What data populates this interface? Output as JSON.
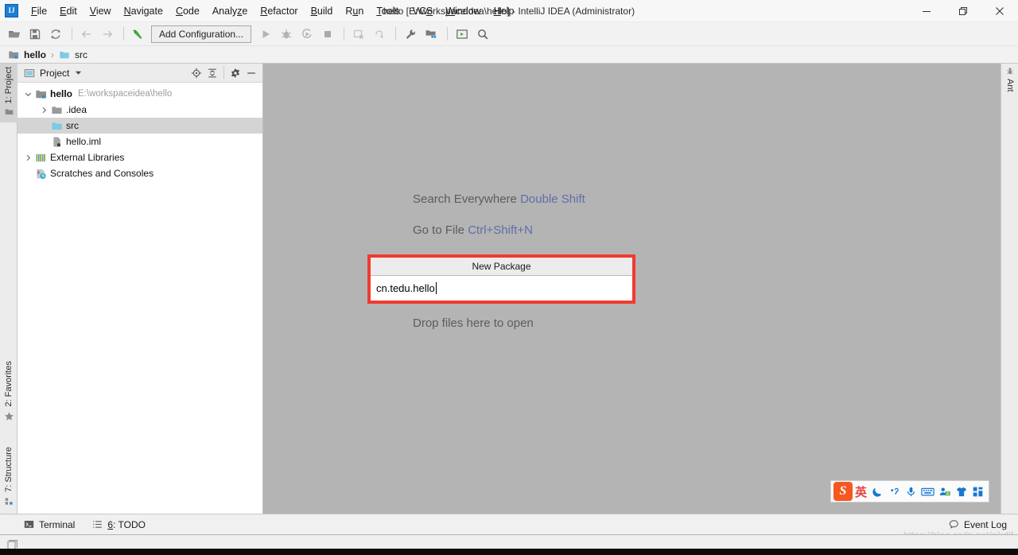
{
  "window": {
    "title": "hello [E:\\workspaceidea\\hello] - IntelliJ IDEA (Administrator)",
    "app_icon": "intellij-idea-logo",
    "controls": {
      "minimize": "minimize-icon",
      "maximize": "maximize-icon",
      "close": "close-icon"
    }
  },
  "menubar": {
    "items": [
      {
        "label": "File",
        "mnemonic": "F"
      },
      {
        "label": "Edit",
        "mnemonic": "E"
      },
      {
        "label": "View",
        "mnemonic": "V"
      },
      {
        "label": "Navigate",
        "mnemonic": "N"
      },
      {
        "label": "Code",
        "mnemonic": "C"
      },
      {
        "label": "Analyze",
        "mnemonic": "z"
      },
      {
        "label": "Refactor",
        "mnemonic": "R"
      },
      {
        "label": "Build",
        "mnemonic": "B"
      },
      {
        "label": "Run",
        "mnemonic": "u"
      },
      {
        "label": "Tools",
        "mnemonic": "T"
      },
      {
        "label": "VCS",
        "mnemonic": "S"
      },
      {
        "label": "Window",
        "mnemonic": "W"
      },
      {
        "label": "Help",
        "mnemonic": "H"
      }
    ]
  },
  "toolbar": {
    "run_configuration": "Add Configuration...",
    "icons": [
      "open-folder-icon",
      "save-all-icon",
      "sync-icon",
      "navigate-back-icon",
      "navigate-forward-icon",
      "build-hammer-icon",
      "run-icon",
      "debug-icon",
      "run-with-coverage-icon",
      "stop-icon",
      "attach-profiler-icon",
      "update-project-icon",
      "settings-wrench-icon",
      "project-structure-icon",
      "terminal-icon",
      "search-icon"
    ]
  },
  "breadcrumb": {
    "items": [
      {
        "label": "hello",
        "icon": "module-icon",
        "bold": true
      },
      {
        "label": "src",
        "icon": "source-folder-icon",
        "bold": false
      }
    ],
    "separator": "›"
  },
  "left_tool_strip": {
    "tabs": [
      {
        "label": "1: Project",
        "mnemonic": "1",
        "icon": "project-icon",
        "active": true
      },
      {
        "label": "2: Favorites",
        "mnemonic": "2",
        "icon": "star-icon",
        "active": false
      },
      {
        "label": "7: Structure",
        "mnemonic": "7",
        "icon": "structure-icon",
        "active": false
      }
    ]
  },
  "right_tool_strip": {
    "tabs": [
      {
        "label": "Ant",
        "icon": "ant-icon",
        "active": false
      }
    ]
  },
  "project_panel": {
    "title": "Project",
    "dropdown_icon": "chevron-down-icon",
    "view_icon": "project-view-icon",
    "actions": [
      "locate-icon",
      "collapse-all-icon",
      "settings-gear-icon",
      "hide-icon"
    ],
    "tree": [
      {
        "label": "hello",
        "path": "E:\\workspaceidea\\hello",
        "icon": "module-icon",
        "indent": 0,
        "twisty": "expanded",
        "bold": true,
        "selected": false
      },
      {
        "label": ".idea",
        "path": "",
        "icon": "folder-gray-icon",
        "indent": 1,
        "twisty": "collapsed",
        "bold": false,
        "selected": false
      },
      {
        "label": "src",
        "path": "",
        "icon": "source-folder-icon",
        "indent": 1,
        "twisty": "none",
        "bold": false,
        "selected": true
      },
      {
        "label": "hello.iml",
        "path": "",
        "icon": "iml-file-icon",
        "indent": 1,
        "twisty": "none",
        "bold": false,
        "selected": false
      },
      {
        "label": "External Libraries",
        "path": "",
        "icon": "libraries-icon",
        "indent": 0,
        "twisty": "collapsed",
        "bold": false,
        "selected": false
      },
      {
        "label": "Scratches and Consoles",
        "path": "",
        "icon": "scratches-icon",
        "indent": 0,
        "twisty": "none",
        "bold": false,
        "selected": false
      }
    ]
  },
  "editor": {
    "hints": [
      {
        "label": "Search Everywhere",
        "shortcut": "Double Shift"
      },
      {
        "label": "Go to File",
        "shortcut": "Ctrl+Shift+N"
      }
    ],
    "drop_text": "Drop files here to open"
  },
  "dialog": {
    "title": "New Package",
    "input_value": "cn.tedu.hello",
    "input_placeholder": "",
    "highlight_color": "#f23a2e"
  },
  "ime": {
    "logo": "sogou-logo-icon",
    "items": [
      {
        "label": "英",
        "name": "language-mode-english"
      },
      {
        "label": "☽",
        "name": "moon-icon"
      },
      {
        "label": "‚’",
        "name": "punctuation-icon"
      },
      {
        "label": "🎙",
        "name": "microphone-icon"
      },
      {
        "label": "⌨",
        "name": "keyboard-icon"
      },
      {
        "label": "▤",
        "name": "input-card-icon"
      },
      {
        "label": "👕",
        "name": "skin-icon"
      },
      {
        "label": "▦",
        "name": "toolbox-icon"
      }
    ]
  },
  "statusbar": {
    "left_items": [
      {
        "label": "Terminal",
        "mnemonic": "",
        "icon": "terminal-icon"
      },
      {
        "label": "6: TODO",
        "mnemonic": "6",
        "icon": "todo-icon"
      }
    ],
    "right_items": [
      {
        "label": "Event Log",
        "icon": "event-log-icon"
      }
    ]
  },
  "watermark": "https://blog.csdn.net/sjkdlf",
  "taskbar": {
    "icon": "window-icon"
  }
}
